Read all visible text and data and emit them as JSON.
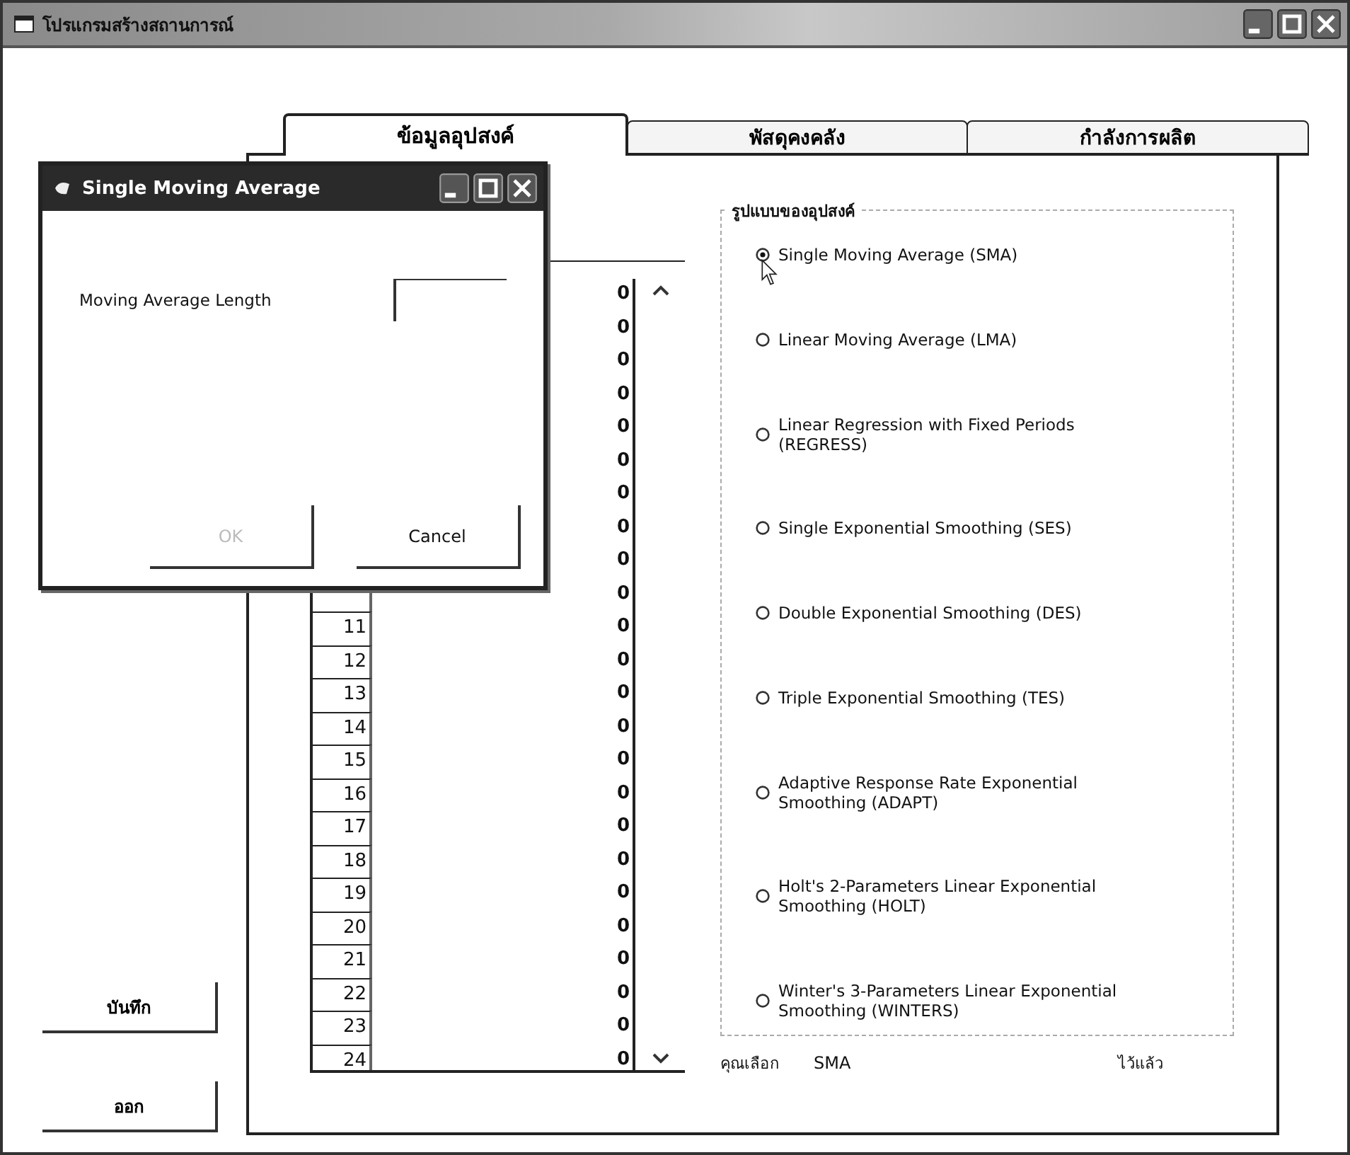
{
  "window": {
    "title": "โปรแกรมสร้างสถานการณ์"
  },
  "tabs": [
    {
      "label": "ข้อมูลอุปสงค์",
      "selected": true
    },
    {
      "label": "พัสดุคงคลัง",
      "selected": false
    },
    {
      "label": "กำลังการผลิต",
      "selected": false
    }
  ],
  "demand_table": {
    "rows": [
      {
        "value": "0"
      },
      {
        "value": "0"
      },
      {
        "value": "0"
      },
      {
        "value": "0"
      },
      {
        "value": "0"
      },
      {
        "value": "0"
      },
      {
        "value": "0"
      },
      {
        "value": "0"
      },
      {
        "value": "0"
      },
      {
        "value": "0"
      },
      {
        "period": "11",
        "value": "0"
      },
      {
        "period": "12",
        "value": "0"
      },
      {
        "period": "13",
        "value": "0"
      },
      {
        "period": "14",
        "value": "0"
      },
      {
        "period": "15",
        "value": "0"
      },
      {
        "period": "16",
        "value": "0"
      },
      {
        "period": "17",
        "value": "0"
      },
      {
        "period": "18",
        "value": "0"
      },
      {
        "period": "19",
        "value": "0"
      },
      {
        "period": "20",
        "value": "0"
      },
      {
        "period": "21",
        "value": "0"
      },
      {
        "period": "22",
        "value": "0"
      },
      {
        "period": "23",
        "value": "0"
      },
      {
        "period": "24",
        "value": "0"
      }
    ]
  },
  "demand_model": {
    "title": "รูปแบบของอุปสงค์",
    "options": [
      {
        "label": "Single Moving Average (SMA)",
        "selected": true
      },
      {
        "label": "Linear Moving Average (LMA)",
        "selected": false
      },
      {
        "label": "Linear Regression with Fixed Periods (REGRESS)",
        "selected": false
      },
      {
        "label": "Single Exponential Smoothing (SES)",
        "selected": false
      },
      {
        "label": "Double Exponential Smoothing (DES)",
        "selected": false
      },
      {
        "label": "Triple Exponential Smoothing (TES)",
        "selected": false
      },
      {
        "label": "Adaptive Response Rate Exponential Smoothing (ADAPT)",
        "selected": false
      },
      {
        "label": "Holt's 2-Parameters Linear Exponential Smoothing (HOLT)",
        "selected": false
      },
      {
        "label": "Winter's 3-Parameters Linear Exponential Smoothing (WINTERS)",
        "selected": false
      }
    ]
  },
  "selection": {
    "label": "คุณเลือก",
    "value": "SMA",
    "status": "ไว้แล้ว"
  },
  "buttons": [
    {
      "label": "บันทึก"
    },
    {
      "label": "ออก"
    }
  ],
  "dialog": {
    "title": "Single Moving Average",
    "field_label": "Moving Average Length",
    "buttons": [
      {
        "label": "OK",
        "disabled": true
      },
      {
        "label": "Cancel",
        "disabled": false
      }
    ]
  }
}
